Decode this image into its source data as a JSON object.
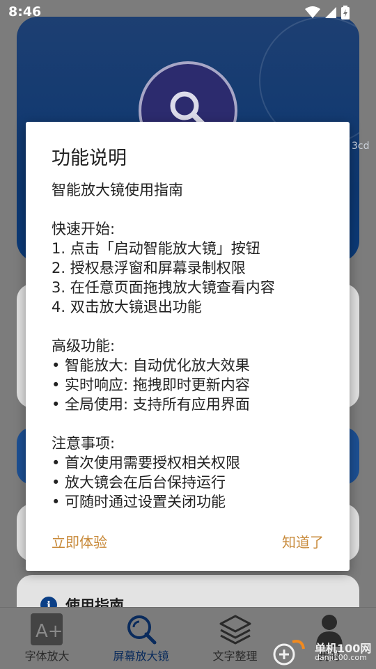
{
  "status_bar": {
    "time": "8:46"
  },
  "hero": {
    "side_text": "3cd"
  },
  "guide_card": {
    "title": "使用指南",
    "info_glyph": "i"
  },
  "bottom_nav": {
    "items": [
      {
        "label": "字体放大",
        "icon": "font-enlarge-icon"
      },
      {
        "label": "屏幕放大镜",
        "icon": "magnifier-icon",
        "active": true
      },
      {
        "label": "文字整理",
        "icon": "layers-icon"
      },
      {
        "label": "我的",
        "icon": "person-icon"
      }
    ]
  },
  "watermark": {
    "text": "单机100网",
    "url": "danji100.com"
  },
  "dialog": {
    "title": "功能说明",
    "intro": "智能放大镜使用指南",
    "quick_start": {
      "heading": "快速开始:",
      "steps": [
        "1. 点击「启动智能放大镜」按钮",
        "2. 授权悬浮窗和屏幕录制权限",
        "3. 在任意页面拖拽放大镜查看内容",
        "4. 双击放大镜退出功能"
      ]
    },
    "advanced": {
      "heading": "高级功能:",
      "items": [
        "• 智能放大: 自动优化放大效果",
        "• 实时响应: 拖拽即时更新内容",
        "• 全局使用: 支持所有应用界面"
      ]
    },
    "notes": {
      "heading": "注意事项:",
      "items": [
        "• 首次使用需要授权相关权限",
        "• 放大镜会在后台保持运行",
        "• 可随时通过设置关闭功能"
      ]
    },
    "btn_try": "立即体验",
    "btn_ok": "知道了"
  },
  "colors": {
    "dialog_button": "#c88a3a",
    "hero_blue": "#0d3770",
    "scrim_gray": "#7c7c7c"
  }
}
